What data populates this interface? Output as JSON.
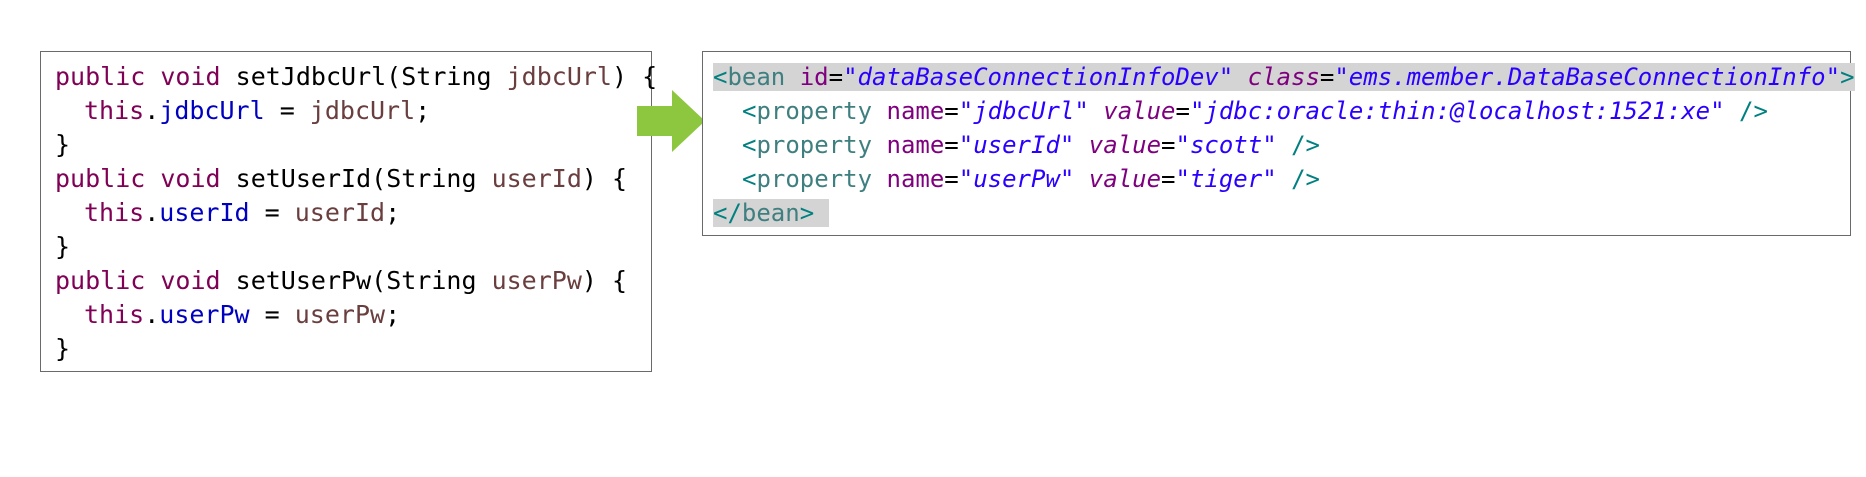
{
  "java_code": {
    "setJdbcUrl": {
      "kw_public": "public",
      "kw_void": "void",
      "method": "setJdbcUrl",
      "open_paren": "(",
      "type": "String",
      "param": "jdbcUrl",
      "close": ") {",
      "this": "this",
      "dot": ".",
      "field": "jdbcUrl",
      "assign": " = ",
      "value": "jdbcUrl",
      "semi": ";",
      "closing_brace": "}"
    },
    "setUserId": {
      "kw_public": "public",
      "kw_void": "void",
      "method": "setUserId",
      "open_paren": "(",
      "type": "String",
      "param": "userId",
      "close": ") {",
      "this": "this",
      "dot": ".",
      "field": "userId",
      "assign": " = ",
      "value": "userId",
      "semi": ";",
      "closing_brace": "}"
    },
    "setUserPw": {
      "kw_public": "public",
      "kw_void": "void",
      "method": "setUserPw",
      "open_paren": "(",
      "type": "String",
      "param": "userPw",
      "close": ") {",
      "this": "this",
      "dot": ".",
      "field": "userPw",
      "assign": " = ",
      "value": "userPw",
      "semi": ";",
      "closing_brace": "}"
    }
  },
  "xml_code": {
    "bean_open": {
      "lt": "<",
      "tag": "bean",
      "id_attr": "id",
      "id_value": "\"dataBaseConnectionInfoDev\"",
      "class_attr": "class",
      "class_value": "\"ems.member.DataBaseConnectionInfo\"",
      "gt": ">",
      "eq": "="
    },
    "properties": [
      {
        "lt": "<",
        "tag": "property",
        "name_attr": "name",
        "name_value": "\"jdbcUrl\"",
        "value_attr": "value",
        "value_value": "\"jdbc:oracle:thin:@localhost:1521:xe\"",
        "end": "/>",
        "eq": "="
      },
      {
        "lt": "<",
        "tag": "property",
        "name_attr": "name",
        "name_value": "\"userId\"",
        "value_attr": "value",
        "value_value": "\"scott\"",
        "end": "/>",
        "eq": "="
      },
      {
        "lt": "<",
        "tag": "property",
        "name_attr": "name",
        "name_value": "\"userPw\"",
        "value_attr": "value",
        "value_value": "\"tiger\"",
        "end": "/>",
        "eq": "="
      }
    ],
    "bean_close": {
      "lt_slash": "</",
      "tag": "bean",
      "gt": ">"
    }
  },
  "colors": {
    "arrow": "#8dc63f",
    "keyword": "#7f0055",
    "field": "#0000c0",
    "param": "#6a3e3e",
    "xml_tag": "#3f7f7f",
    "xml_attr": "#7f007f",
    "xml_value": "#2a00ff",
    "highlight": "#d4d4d4"
  },
  "icons": {
    "arrow": "right-arrow-icon"
  }
}
